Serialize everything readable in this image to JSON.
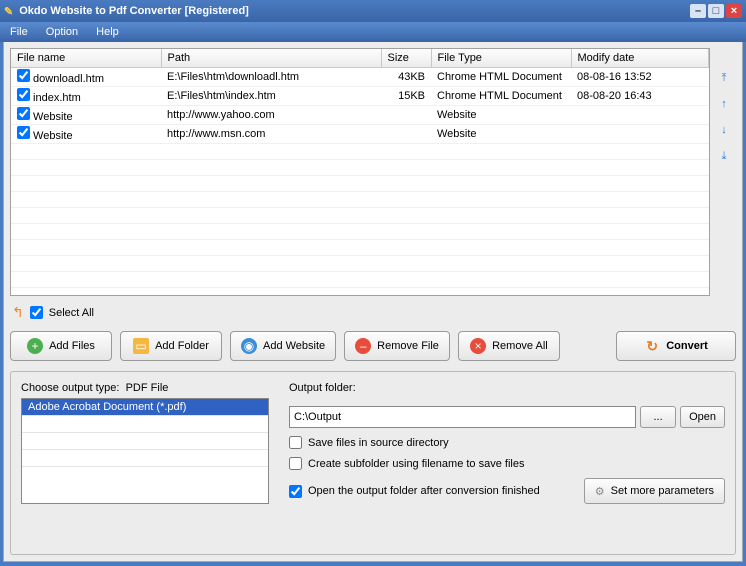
{
  "window": {
    "title": "Okdo Website to Pdf Converter [Registered]"
  },
  "menu": {
    "file": "File",
    "option": "Option",
    "help": "Help"
  },
  "table": {
    "headers": {
      "filename": "File name",
      "path": "Path",
      "size": "Size",
      "filetype": "File Type",
      "modify": "Modify date"
    },
    "rows": [
      {
        "name": "downloadl.htm",
        "path": "E:\\Files\\htm\\downloadl.htm",
        "size": "43KB",
        "type": "Chrome HTML Document",
        "modify": "08-08-16 13:52"
      },
      {
        "name": "index.htm",
        "path": "E:\\Files\\htm\\index.htm",
        "size": "15KB",
        "type": "Chrome HTML Document",
        "modify": "08-08-20 16:43"
      },
      {
        "name": "Website",
        "path": "http://www.yahoo.com",
        "size": "",
        "type": "Website",
        "modify": ""
      },
      {
        "name": "Website",
        "path": "http://www.msn.com",
        "size": "",
        "type": "Website",
        "modify": ""
      }
    ]
  },
  "selectall": "Select All",
  "buttons": {
    "addfiles": "Add Files",
    "addfolder": "Add Folder",
    "addwebsite": "Add Website",
    "removefile": "Remove File",
    "removeall": "Remove All",
    "convert": "Convert"
  },
  "output": {
    "choose_label": "Choose output type:",
    "type_label": "PDF File",
    "type_option": "Adobe Acrobat Document (*.pdf)",
    "folder_label": "Output folder:",
    "folder_value": "C:\\Output",
    "browse": "...",
    "open": "Open",
    "save_source": "Save files in source directory",
    "create_sub": "Create subfolder using filename to save files",
    "open_after": "Open the output folder after conversion finished",
    "more_params": "Set more parameters"
  }
}
